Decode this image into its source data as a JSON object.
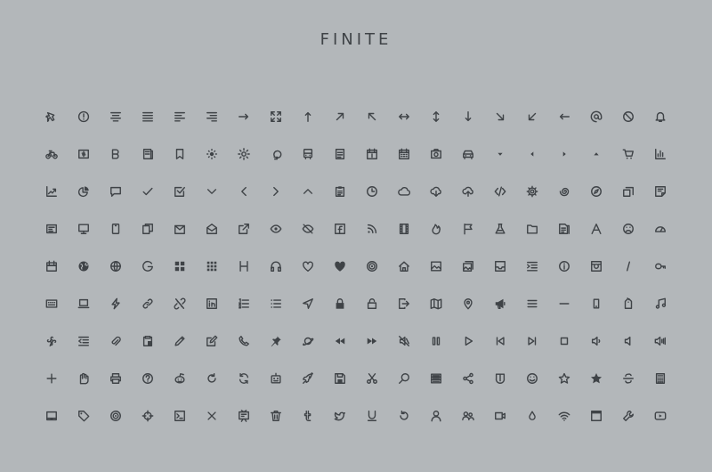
{
  "title": "FINITE",
  "colors": {
    "background": "#b3b7ba",
    "icon": "#3f4347"
  },
  "icons": [
    "airplane-icon",
    "alert-circle-icon",
    "align-center-icon",
    "align-justify-icon",
    "align-left-icon",
    "align-right-icon",
    "arrow-right-icon",
    "expand-icon",
    "arrow-up-icon",
    "arrow-up-right-icon",
    "arrow-up-left-icon",
    "arrows-horizontal-icon",
    "arrows-vertical-icon",
    "arrow-down-icon",
    "arrow-down-right-icon",
    "arrow-down-left-icon",
    "arrow-left-icon",
    "at-sign-icon",
    "ban-icon",
    "bell-icon",
    "bicycle-icon",
    "money-icon",
    "bold-icon",
    "book-icon",
    "bookmark-icon",
    "brightness-low-icon",
    "brightness-high-icon",
    "lightbulb-icon",
    "bus-icon",
    "document-icon",
    "calendar-day-icon",
    "calendar-icon",
    "camera-icon",
    "car-icon",
    "caret-down-icon",
    "caret-left-icon",
    "caret-right-icon",
    "caret-up-icon",
    "cart-icon",
    "bar-chart-icon",
    "trend-chart-icon",
    "pie-chart-icon",
    "chat-icon",
    "check-icon",
    "checkbox-icon",
    "chevron-down-icon",
    "chevron-left-icon",
    "chevron-right-icon",
    "chevron-up-icon",
    "clipboard-icon",
    "clock-icon",
    "cloud-icon",
    "cloud-download-icon",
    "cloud-upload-icon",
    "code-icon",
    "gear-icon",
    "spiral-icon",
    "compass-icon",
    "copy-icon",
    "note-icon",
    "card-icon",
    "desktop-icon",
    "mobile-icon",
    "documents-icon",
    "inbox-mail-icon",
    "envelope-open-icon",
    "external-link-icon",
    "eye-icon",
    "eye-off-icon",
    "facebook-icon",
    "rss-icon",
    "film-icon",
    "fire-icon",
    "flag-icon",
    "flask-icon",
    "folder-icon",
    "file-copy-icon",
    "font-icon",
    "sad-face-icon",
    "gauge-icon",
    "calendar-event-icon",
    "globe-filled-icon",
    "globe-icon",
    "google-icon",
    "grid-large-icon",
    "grid-small-icon",
    "heading-icon",
    "headphones-icon",
    "heart-outline-icon",
    "heart-filled-icon",
    "target-icon",
    "home-icon",
    "image-icon",
    "images-icon",
    "inbox-icon",
    "indent-icon",
    "info-icon",
    "instagram-icon",
    "italic-icon",
    "key-icon",
    "keyboard-icon",
    "laptop-icon",
    "lightning-icon",
    "link-icon",
    "unlink-icon",
    "linkedin-icon",
    "ordered-list-icon",
    "unordered-list-icon",
    "location-arrow-icon",
    "lock-icon",
    "unlock-icon",
    "sign-in-icon",
    "map-icon",
    "map-pin-icon",
    "megaphone-icon",
    "menu-icon",
    "minus-icon",
    "phone-device-icon",
    "tag-hang-icon",
    "music-icon",
    "flower-icon",
    "outdent-icon",
    "paperclip-icon",
    "paste-icon",
    "pencil-icon",
    "edit-icon",
    "phone-icon",
    "pin-icon",
    "planet-icon",
    "rewind-icon",
    "fast-forward-icon",
    "mute-icon",
    "pause-icon",
    "play-icon",
    "skip-back-icon",
    "skip-forward-icon",
    "stop-icon",
    "volume-low-icon",
    "volume-mid-icon",
    "volume-high-icon",
    "plus-icon",
    "hand-icon",
    "printer-icon",
    "help-icon",
    "reddit-icon",
    "redo-icon",
    "refresh-icon",
    "robot-icon",
    "rocket-icon",
    "save-icon",
    "scissors-icon",
    "search-icon",
    "server-icon",
    "share-icon",
    "shield-icon",
    "smile-icon",
    "star-outline-icon",
    "star-filled-icon",
    "strikethrough-icon",
    "calculator-icon",
    "tablet-icon",
    "tag-icon",
    "radio-target-icon",
    "crosshair-icon",
    "terminal-icon",
    "close-icon",
    "tv-icon",
    "trash-icon",
    "tumblr-icon",
    "twitter-icon",
    "underline-icon",
    "undo-icon",
    "user-icon",
    "users-icon",
    "video-camera-icon",
    "droplet-icon",
    "wifi-icon",
    "window-icon",
    "wrench-icon",
    "youtube-icon"
  ]
}
